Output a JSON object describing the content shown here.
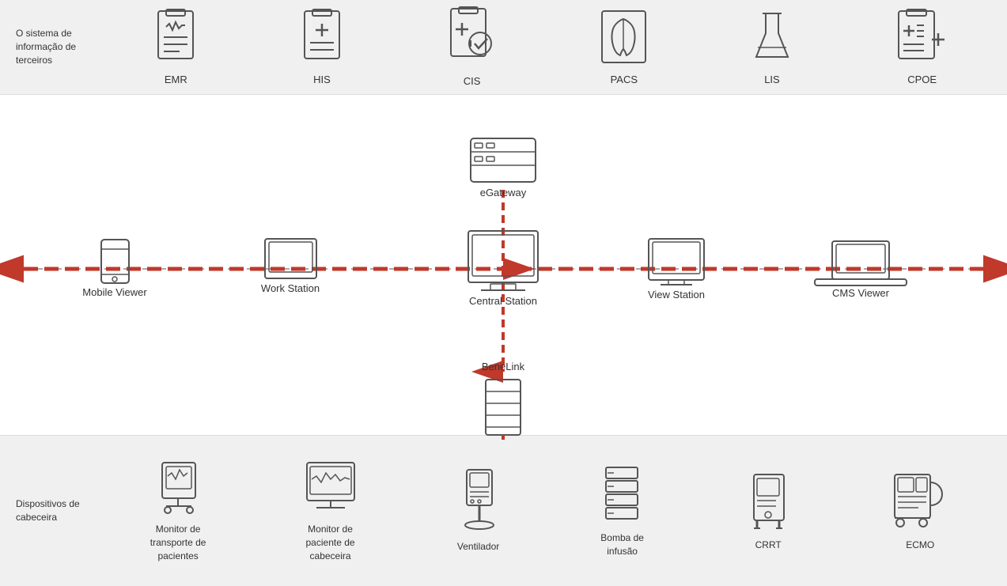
{
  "top": {
    "section_label": "O sistema de informação de terceiros",
    "items": [
      {
        "id": "emr",
        "label": "EMR"
      },
      {
        "id": "his",
        "label": "HIS"
      },
      {
        "id": "cis",
        "label": "CIS"
      },
      {
        "id": "pacs",
        "label": "PACS"
      },
      {
        "id": "lis",
        "label": "LIS"
      },
      {
        "id": "cpoe",
        "label": "CPOE"
      }
    ]
  },
  "middle": {
    "nodes": [
      {
        "id": "mobile-viewer",
        "label": "Mobile Viewer"
      },
      {
        "id": "work-station",
        "label": "Work Station"
      },
      {
        "id": "central-station",
        "label": "Central Station"
      },
      {
        "id": "view-station",
        "label": "View Station"
      },
      {
        "id": "cms-viewer",
        "label": "CMS Viewer"
      }
    ],
    "egateway_label": "eGateway",
    "benelink_label": "BeneLink"
  },
  "bottom": {
    "section_label": "Dispositivos de cabeceira",
    "items": [
      {
        "id": "monitor-transporte",
        "label": "Monitor de\ntransporte de\npacientes"
      },
      {
        "id": "monitor-paciente",
        "label": "Monitor de\npaciente de\ncabeceira"
      },
      {
        "id": "ventilador",
        "label": "Ventilador"
      },
      {
        "id": "bomba",
        "label": "Bomba de\ninfusão"
      },
      {
        "id": "crrt",
        "label": "CRRT"
      },
      {
        "id": "ecmo",
        "label": "ECMO"
      }
    ]
  }
}
